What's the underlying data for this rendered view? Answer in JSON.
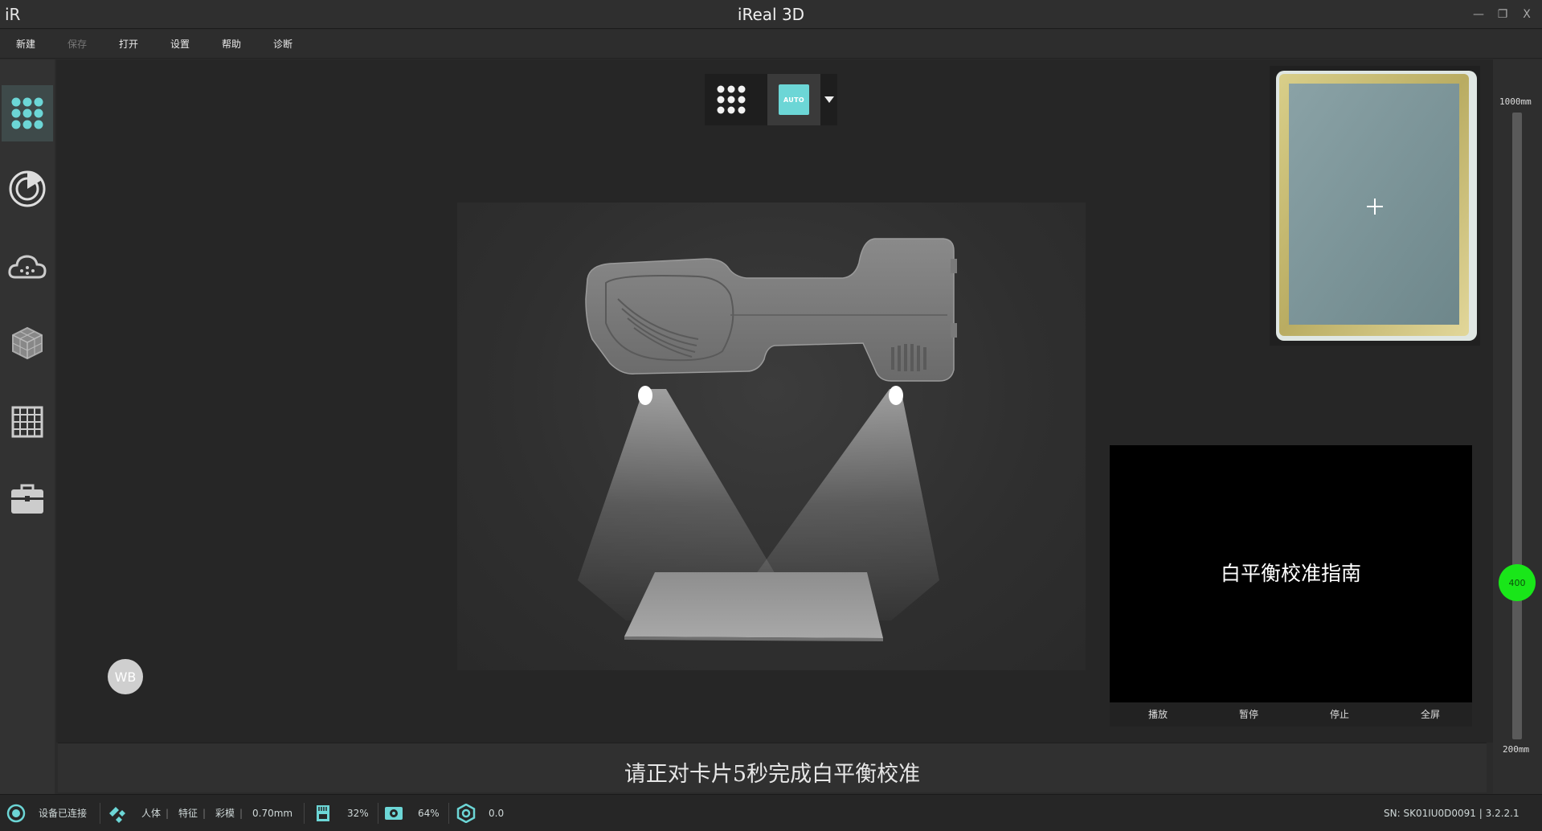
{
  "window": {
    "logo": "iR",
    "title": "iReal 3D",
    "minimize": "—",
    "restore": "❐",
    "close": "X"
  },
  "menu": {
    "new": "新建",
    "save": "保存",
    "open": "打开",
    "settings": "设置",
    "help": "帮助",
    "diagnose": "诊断"
  },
  "sidebar": {
    "items": [
      {
        "name": "scan-mode",
        "icon": "dot-grid-icon",
        "active": true
      },
      {
        "name": "alignment",
        "icon": "target-icon",
        "active": false
      },
      {
        "name": "point-cloud",
        "icon": "cloud-icon",
        "active": false
      },
      {
        "name": "mesh",
        "icon": "mesh-cube-icon",
        "active": false
      },
      {
        "name": "texture",
        "icon": "grid-icon",
        "active": false
      },
      {
        "name": "tools",
        "icon": "toolbox-icon",
        "active": false
      }
    ]
  },
  "toolbar": {
    "auto_label": "AUTO"
  },
  "wb_button": "WB",
  "video": {
    "title": "白平衡校准指南",
    "play": "播放",
    "pause": "暂停",
    "stop": "停止",
    "fullscreen": "全屏"
  },
  "slider": {
    "max_label": "1000mm",
    "min_label": "200mm",
    "value_label": "400",
    "min": 200,
    "max": 1000,
    "value": 400
  },
  "hint": "请正对卡片5秒完成白平衡校准",
  "status": {
    "connection": "设备已连接",
    "mode_body": "人体",
    "mode_feature": "特征",
    "mode_color": "彩模",
    "resolution": "0.70mm",
    "memory_percent": "32%",
    "disk_percent": "64%",
    "angle_value": "0.0",
    "serial": "SN: SK01IU0D0091 | 3.2.2.1"
  },
  "colors": {
    "accent": "#6cd6d6",
    "slider_knob": "#19e619"
  }
}
